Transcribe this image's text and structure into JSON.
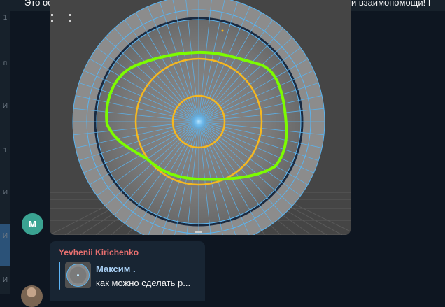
{
  "pinned": {
    "text": "Это основная ветка чата Maya 3D. Чат создан для общения, обмена опытом и взаимопомощи! Г"
  },
  "rail": {
    "labels": [
      "1",
      "п",
      "И",
      "1",
      "И",
      "И",
      "И"
    ]
  },
  "messages": {
    "avatar_letter": "М",
    "reply": {
      "sender": "Yevhenii Kirichenko",
      "quote_author": "Максим .",
      "quote_text": "как можно сделать р..."
    }
  },
  "colors": {
    "background": "#0e1621",
    "bubble": "#182533",
    "sender_name": "#e66f6f",
    "quote_author": "#a9d0f5",
    "green_annotation": "#7cfc00",
    "orange_circle": "#f5b820",
    "wire_blue": "#5ab4f0"
  }
}
